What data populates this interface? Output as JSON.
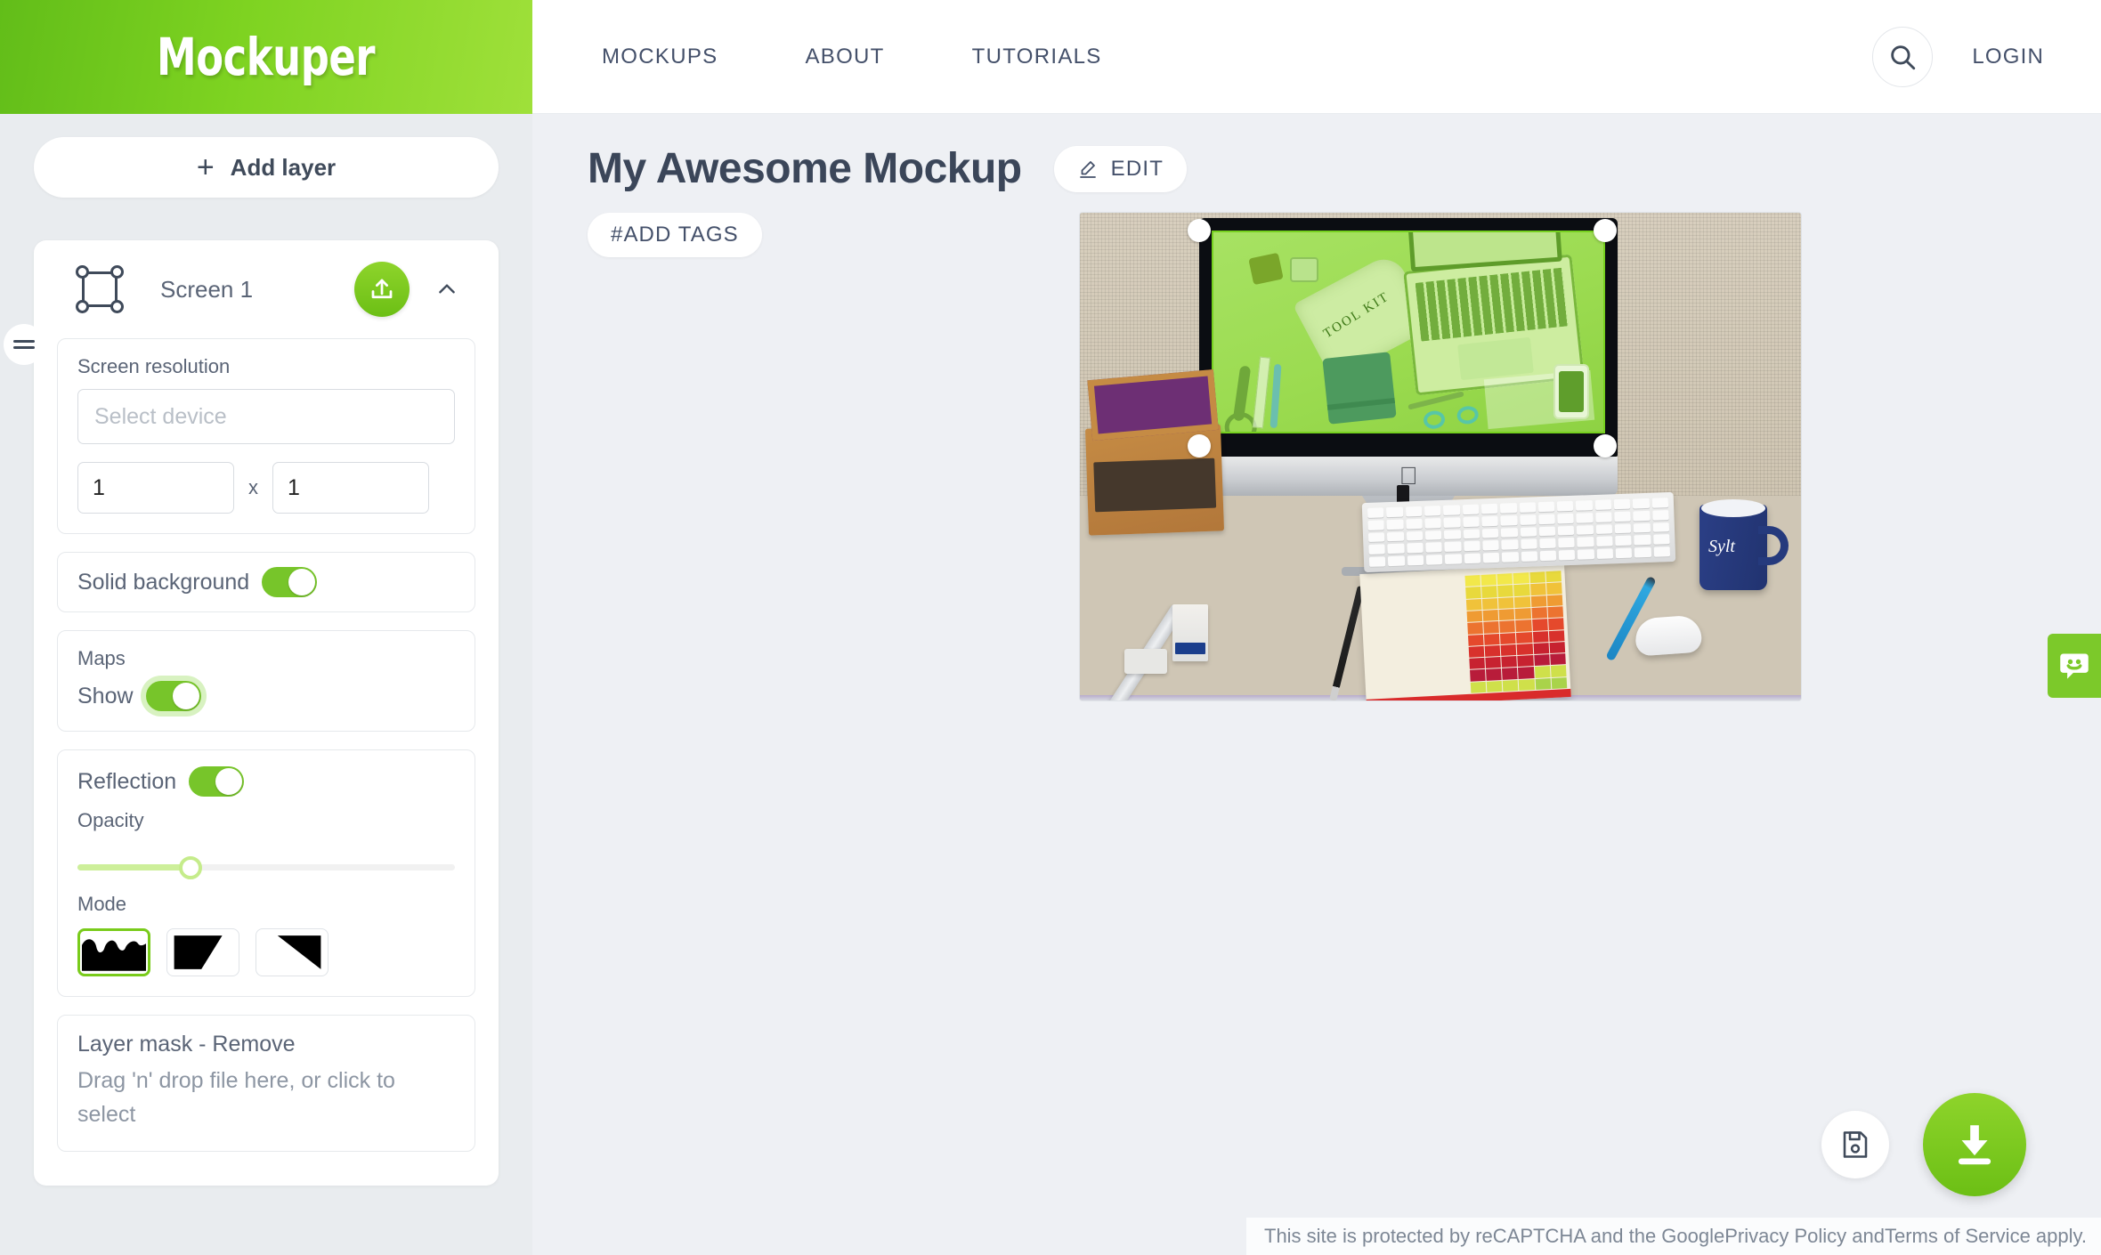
{
  "header": {
    "logo": "Mockuper",
    "nav": [
      {
        "label": "MOCKUPS",
        "name": "nav-mockups"
      },
      {
        "label": "ABOUT",
        "name": "nav-about"
      },
      {
        "label": "TUTORIALS",
        "name": "nav-tutorials"
      }
    ],
    "search_icon": "search-icon",
    "login_label": "LOGIN"
  },
  "sidebar": {
    "add_layer_label": "Add layer",
    "add_layer_icon": "plus-icon",
    "layer": {
      "name": "Screen 1",
      "drag_handle_icon": "drag-handle-icon",
      "type_icon": "screen-frame-icon",
      "upload_icon": "upload-icon",
      "collapse_icon": "chevron-up-icon"
    },
    "resolution": {
      "label": "Screen resolution",
      "device_placeholder": "Select device",
      "device_value": "",
      "width": "1",
      "height": "1",
      "separator": "x"
    },
    "solid_background": {
      "label": "Solid background",
      "enabled": true
    },
    "maps": {
      "label": "Maps",
      "show_label": "Show",
      "enabled": true
    },
    "reflection": {
      "label": "Reflection",
      "enabled": true,
      "opacity_label": "Opacity",
      "opacity_percent": 30,
      "mode_label": "Mode",
      "modes": [
        {
          "name": "mode-waves",
          "selected": true
        },
        {
          "name": "mode-slant",
          "selected": false
        },
        {
          "name": "mode-triangle",
          "selected": false
        }
      ]
    },
    "layer_mask": {
      "title": "Layer mask - Remove",
      "hint": "Drag 'n' drop file here, or click to select"
    }
  },
  "main": {
    "title": "My Awesome Mockup",
    "edit_label": "EDIT",
    "edit_icon": "pencil-icon",
    "tags_label": "#ADD TAGS",
    "preview": {
      "screen_text": "TOOL KIT",
      "mug_text": "Sylt",
      "handles": 4
    },
    "save_icon": "save-floppy-icon",
    "download_icon": "download-icon"
  },
  "chat": {
    "icon": "chat-smiley-icon"
  },
  "footer": {
    "recaptcha": "This site is protected by reCAPTCHA and the GooglePrivacy Policy andTerms of Service apply."
  },
  "colors": {
    "brand_green": "#7ed321",
    "accent_green": "#77c52a",
    "text_dark": "#3f4a5a",
    "sidebar_bg": "#e9ecef",
    "canvas_bg": "#eef0f4"
  }
}
